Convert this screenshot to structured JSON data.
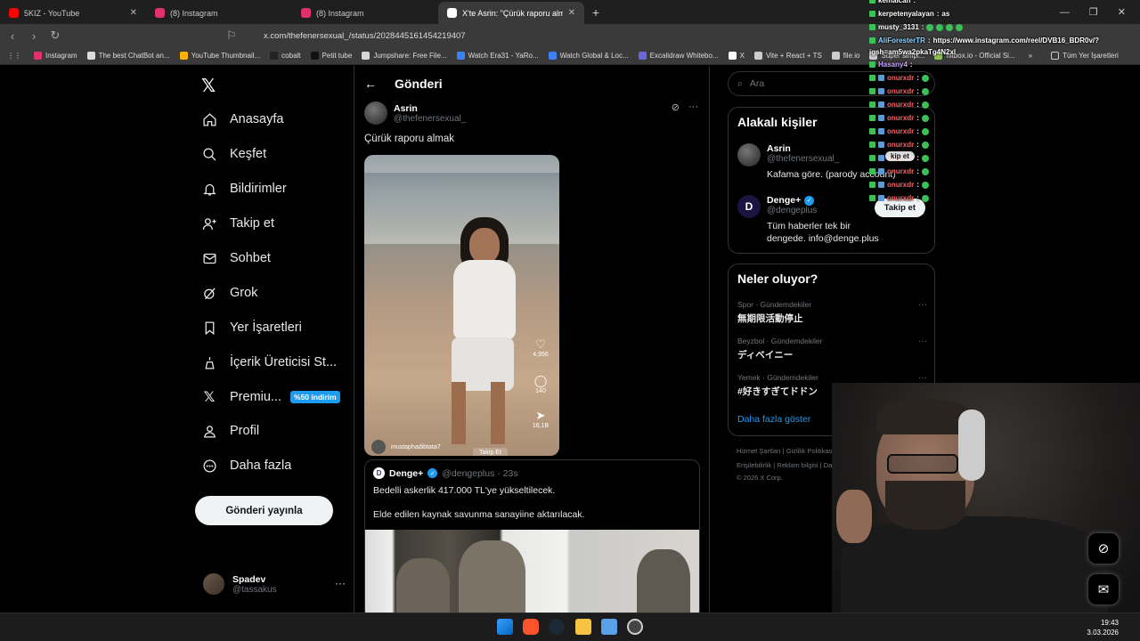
{
  "tabs": [
    {
      "title": "5KIZ - YouTube",
      "color": "#ff0000"
    },
    {
      "title": "(8) Instagram",
      "color": "#e1306c"
    },
    {
      "title": "(8) Instagram",
      "color": "#e1306c"
    },
    {
      "title": "X'te Asrin: \"Çürük raporu alma…",
      "color": "#ffffff"
    }
  ],
  "url": "x.com/thefenersexual_/status/2028445161454219407",
  "bookmarks": [
    "Instagram",
    "The best ChatBot an...",
    "YouTube Thumbnail...",
    "cobalt",
    "Petit tube",
    "Jumpshare: Free File...",
    "Watch Era31 - YaRo...",
    "Watch Global & Loc...",
    "Excalidraw Whitebo...",
    "X",
    "Vite + React + TS",
    "file.io",
    "Super simpl...",
    "hitbox.io - Official Si...",
    "Tüm Yer İşaretleri"
  ],
  "nav": {
    "items": [
      {
        "label": "Anasayfa",
        "icon": "home-icon"
      },
      {
        "label": "Keşfet",
        "icon": "search-icon"
      },
      {
        "label": "Bildirimler",
        "icon": "bell-icon"
      },
      {
        "label": "Takip et",
        "icon": "add-person-icon"
      },
      {
        "label": "Sohbet",
        "icon": "mail-icon"
      },
      {
        "label": "Grok",
        "icon": "grok-icon"
      },
      {
        "label": "Yer İşaretleri",
        "icon": "bookmark-icon"
      },
      {
        "label": "İçerik Üreticisi St...",
        "icon": "creator-icon"
      },
      {
        "label": "Premiu...",
        "icon": "x-premium-icon"
      },
      {
        "label": "Profil",
        "icon": "profile-icon"
      },
      {
        "label": "Daha fazla",
        "icon": "more-circle-icon"
      }
    ],
    "premium_badge": "%50 indirim",
    "post_button": "Gönderi yayınla",
    "account_name": "Spadev",
    "account_handle": "@tassakus"
  },
  "post": {
    "header": "Gönderi",
    "author": "Asrin",
    "handle": "@thefenersexual_",
    "text": "Çürük raporu almak",
    "video": {
      "likes": "4,956",
      "comments": "140",
      "shares": "16,1B",
      "user": "mustaphadibtata7",
      "follow": "Takip Et"
    }
  },
  "quote": {
    "name": "Denge+",
    "handle": "@dengeplus · 23s",
    "line1": "Bedelli askerlik 417.000 TL'ye yükseltilecek.",
    "line2": "Elde edilen kaynak savunma sanayiine aktarılacak."
  },
  "sidebar": {
    "search_placeholder": "Ara",
    "related_title": "Alakalı kişiler",
    "people": [
      {
        "name": "Asrin",
        "handle": "@thefenersexual_",
        "bio": "Kafama göre. (parody account)"
      },
      {
        "name": "Denge+",
        "handle": "@dengeplus",
        "bio": "Tüm haberler tek bir dengede. info@denge.plus",
        "follow": "Takip et"
      }
    ],
    "trends_title": "Neler oluyor?",
    "trends": [
      {
        "category": "Spor · Gündemdekiler",
        "topic": "無期限活動停止"
      },
      {
        "category": "Beyzbol · Gündemdekiler",
        "topic": "ディベイニー"
      },
      {
        "category": "Yemek · Gündemdekiler",
        "topic": "#好きすぎてドドン"
      }
    ],
    "show_more": "Daha fazla göster",
    "footer1": "Hizmet Şartları  |  Gizlilik Politikası  |",
    "footer2": "Erişilebilirlik  |  Reklam bilgisi  |  Daha",
    "footer3": "© 2026 X Corp."
  },
  "chat": [
    {
      "user": "kemalcan",
      "msg": ""
    },
    {
      "user": "kerpetenyalayan",
      "msg": "as"
    },
    {
      "user": "musty_3131",
      "msg": ""
    },
    {
      "user": "AliForesterTR",
      "msg": "https://www.instagram.com/reel/DVB16_BDR0v/?"
    },
    {
      "user": "",
      "msg": "igsh=am5wa2pkaTg4N2xl"
    },
    {
      "user": "Hasany4",
      "msg": ""
    },
    {
      "user": "onurxdr",
      "msg": ""
    },
    {
      "user": "onurxdr",
      "msg": ""
    },
    {
      "user": "onurxdr",
      "msg": ""
    },
    {
      "user": "onurxdr",
      "msg": ""
    },
    {
      "user": "onurxdr",
      "msg": ""
    },
    {
      "user": "onurxdr",
      "msg": ""
    },
    {
      "user": "onurxdr",
      "msg": ""
    },
    {
      "user": "onurxdr",
      "msg": ""
    },
    {
      "user": "onurxdr",
      "msg": ""
    },
    {
      "user": "onurxdr",
      "msg": ""
    }
  ],
  "chat_overlay_follow": "kip et",
  "clock": {
    "time": "19:43",
    "date": "3.03.2026"
  }
}
